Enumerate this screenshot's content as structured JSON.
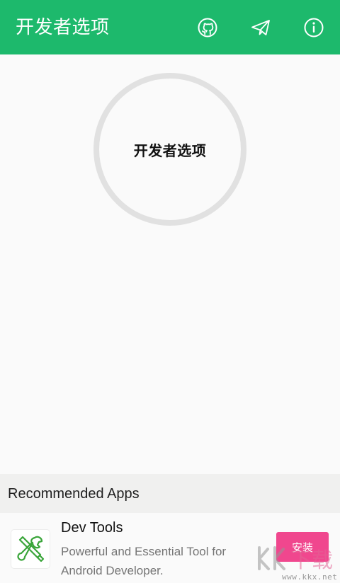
{
  "toolbar": {
    "title": "开发者选项",
    "background_color": "#1db96c",
    "actions": [
      {
        "name": "github",
        "icon": "github-icon"
      },
      {
        "name": "telegram",
        "icon": "paper-plane-icon"
      },
      {
        "name": "info",
        "icon": "info-icon"
      }
    ]
  },
  "main": {
    "toggle_label": "开发者选项",
    "ring_color": "#e1e1e1"
  },
  "recommended": {
    "title": "Recommended Apps",
    "apps": [
      {
        "name": "Dev Tools",
        "description": "Powerful and Essential Tool for Android Developer.",
        "install_label": "安装",
        "icon": "wrench-screwdriver-icon",
        "install_color": "#f0478e"
      }
    ]
  },
  "watermark": {
    "text": "www.kkx.net"
  }
}
